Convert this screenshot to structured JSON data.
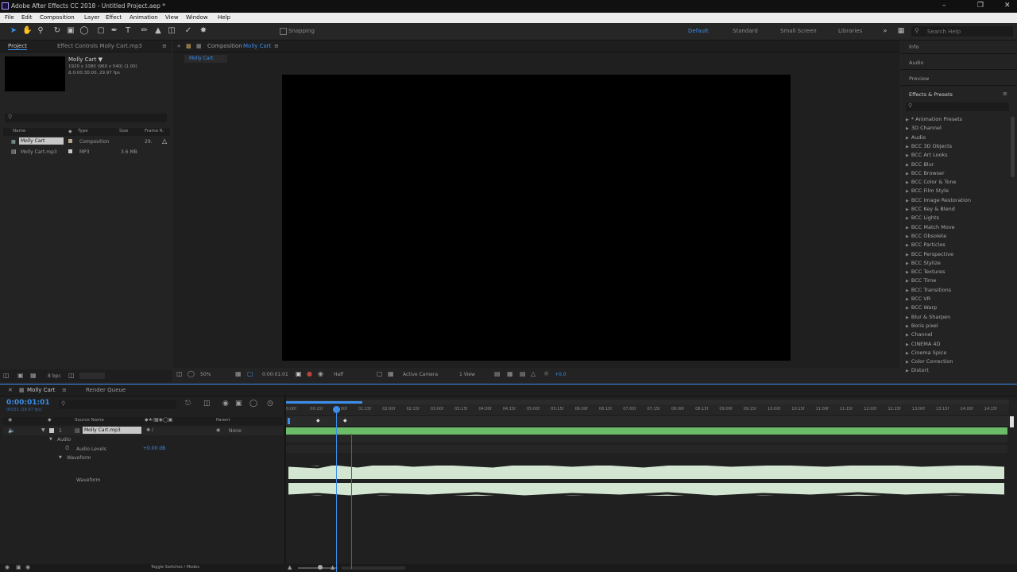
{
  "window": {
    "title": "Adobe After Effects CC 2018 - Untitled Project.aep *"
  },
  "menu": [
    "File",
    "Edit",
    "Composition",
    "Layer",
    "Effect",
    "Animation",
    "View",
    "Window",
    "Help"
  ],
  "toolbar": {
    "snapping": "Snapping",
    "workspaces": [
      "Default",
      "Standard",
      "Small Screen",
      "Libraries"
    ],
    "search_placeholder": "Search Help"
  },
  "project": {
    "tab": "Project",
    "effect_controls_tab": "Effect Controls Molly Cart.mp3",
    "selected_name": "Molly Cart ▼",
    "selected_info_1": "1920 x 1080 (960 x 540) (1.00)",
    "selected_info_2": "Δ 0:00:30:00, 29.97 fps",
    "columns": [
      "Name",
      "Type",
      "Size",
      "Frame R."
    ],
    "items": [
      {
        "name": "Molly Cart",
        "type": "Composition",
        "size": "",
        "fps": "29."
      },
      {
        "name": "Molly Cart.mp3",
        "type": "MP3",
        "size": "3.6 MB",
        "fps": ""
      }
    ],
    "bpc": "8 bpc"
  },
  "composition": {
    "tab_prefix": "Composition",
    "tab_name": "Molly Cart",
    "flow_tab": "Molly Cart",
    "zoom": "50%",
    "timecode": "0:00:01:01",
    "resolution": "Half",
    "camera": "Active Camera",
    "views": "1 View",
    "exposure": "+0.0"
  },
  "right_panels": {
    "info": "Info",
    "audio": "Audio",
    "preview": "Preview",
    "effects": "Effects & Presets",
    "effect_list": [
      "* Animation Presets",
      "3D Channel",
      "Audio",
      "BCC 3D Objects",
      "BCC Art Looks",
      "BCC Blur",
      "BCC Browser",
      "BCC Color & Tone",
      "BCC Film Style",
      "BCC Image Restoration",
      "BCC Key & Blend",
      "BCC Lights",
      "BCC Match Move",
      "BCC Obsolete",
      "BCC Particles",
      "BCC Perspective",
      "BCC Stylize",
      "BCC Textures",
      "BCC Time",
      "BCC Transitions",
      "BCC VR",
      "BCC Warp",
      "Blur & Sharpen",
      "Boris pixel",
      "Channel",
      "CINEMA 4D",
      "Cinema Spice",
      "Color Correction",
      "Distort"
    ]
  },
  "timeline": {
    "tab": "Molly Cart",
    "render_queue": "Render Queue",
    "timecode": "0:00:01:01",
    "frames": "00031 (29.97 fps)",
    "columns": {
      "source": "Source Name",
      "parent": "Parent"
    },
    "layer": {
      "num": "1",
      "name": "Molly Cart.mp3",
      "parent": "None"
    },
    "audio": "Audio",
    "audio_levels": "Audio Levels",
    "audio_levels_value": "+0.00 dB",
    "waveform_group": "Waveform",
    "waveform": "Waveform",
    "toggle_switches": "Toggle Switches / Modes",
    "ticks": [
      "0:00f",
      "00:15f",
      "01:00f",
      "01:15f",
      "02:00f",
      "02:15f",
      "03:00f",
      "03:15f",
      "04:00f",
      "04:15f",
      "05:00f",
      "05:15f",
      "06:00f",
      "06:15f",
      "07:00f",
      "07:15f",
      "08:00f",
      "08:15f",
      "09:00f",
      "09:15f",
      "10:00f",
      "10:15f",
      "11:00f",
      "11:15f",
      "12:00f",
      "12:15f",
      "13:00f",
      "13:15f",
      "14:00f",
      "14:15f"
    ]
  },
  "colors": {
    "accent": "#3b8eea",
    "waveform": "#d3e6d1",
    "layer_bar": "#6cbb69",
    "playhead": "#3b8eea",
    "marker": "#c0392b"
  }
}
